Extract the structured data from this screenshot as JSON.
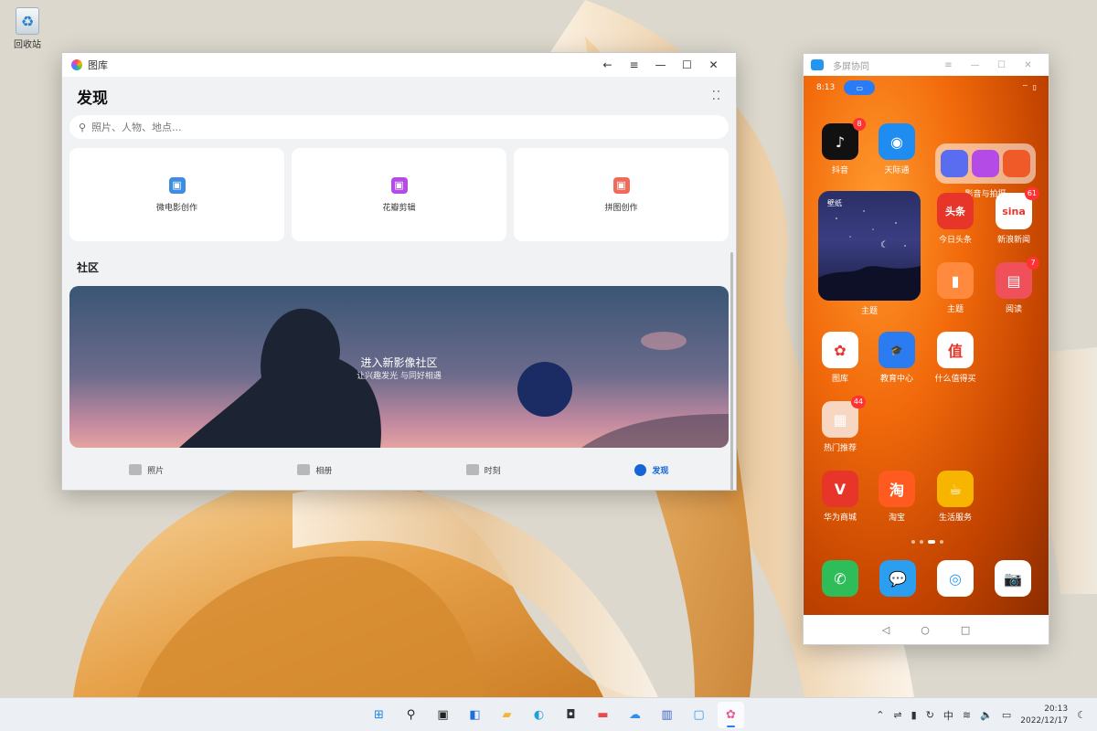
{
  "desktop": {
    "recycle_bin_label": "回收站"
  },
  "gallery_window": {
    "app_title": "图库",
    "page_title": "发现",
    "search": {
      "placeholder": "照片、人物、地点..."
    },
    "cards": [
      {
        "label": "微电影创作",
        "icon": "film-icon",
        "color": "#3d8de0"
      },
      {
        "label": "花瓣剪辑",
        "icon": "petal-edit-icon",
        "color": "#b44be6"
      },
      {
        "label": "拼图创作",
        "icon": "collage-icon",
        "color": "#f06a5a"
      }
    ],
    "section_title": "社区",
    "banner": {
      "title": "进入新影像社区",
      "subtitle": "让兴趣发光 与同好相遇"
    },
    "tabs": [
      {
        "label": "照片",
        "icon": "photo-icon",
        "active": false
      },
      {
        "label": "相册",
        "icon": "album-icon",
        "active": false
      },
      {
        "label": "时刻",
        "icon": "star-icon",
        "active": false
      },
      {
        "label": "发现",
        "icon": "discover-icon",
        "active": true
      }
    ]
  },
  "phone_window": {
    "title": "多屏协同",
    "status": {
      "time": "8:13"
    },
    "apps": [
      {
        "name": "抖音",
        "color": "#111111",
        "glyph": "♪",
        "badge": "8"
      },
      {
        "name": "天际通",
        "color": "#1e8cf0",
        "glyph": "◉",
        "badge": ""
      },
      {
        "name": "今日头条",
        "color": "#e8352a",
        "glyph": "头条",
        "badge": ""
      },
      {
        "name": "新浪新闻",
        "color": "#ffffff",
        "glyph": "sina",
        "badge": "61"
      },
      {
        "name": "主题",
        "color": "#ff8a3d",
        "glyph": "▮",
        "badge": ""
      },
      {
        "name": "阅读",
        "color": "#f0505a",
        "glyph": "▤",
        "badge": "7"
      },
      {
        "name": "图库",
        "color": "#ffffff",
        "glyph": "✿",
        "badge": ""
      },
      {
        "name": "教育中心",
        "color": "#2b7cf0",
        "glyph": "🎓",
        "badge": ""
      },
      {
        "name": "什么值得买",
        "color": "#ffffff",
        "glyph": "值",
        "badge": ""
      },
      {
        "name": "热门推荐",
        "color": "#f7d7c2",
        "glyph": "▦",
        "badge": "44"
      },
      {
        "name": "华为商城",
        "color": "#e8352a",
        "glyph": "V",
        "badge": ""
      },
      {
        "name": "淘宝",
        "color": "#ff5a1f",
        "glyph": "淘",
        "badge": ""
      },
      {
        "name": "生活服务",
        "color": "#f7b500",
        "glyph": "☕",
        "badge": ""
      }
    ],
    "folder_label": "影音与拍摄",
    "widget": {
      "title": "壁纸",
      "label": "主题"
    },
    "dock": [
      {
        "name": "phone",
        "color": "#2ebd59",
        "glyph": "✆"
      },
      {
        "name": "messages",
        "color": "#2b9ef0",
        "glyph": "💬"
      },
      {
        "name": "browser",
        "color": "#ffffff",
        "glyph": "◎"
      },
      {
        "name": "camera",
        "color": "#ffffff",
        "glyph": "📷"
      }
    ]
  },
  "taskbar": {
    "apps": [
      {
        "name": "start",
        "glyph": "⊞",
        "color": "#1e88e5"
      },
      {
        "name": "search",
        "glyph": "⚲",
        "color": "#222"
      },
      {
        "name": "task-view",
        "glyph": "▣",
        "color": "#222"
      },
      {
        "name": "widgets",
        "glyph": "◧",
        "color": "#1e6fd9"
      },
      {
        "name": "explorer",
        "glyph": "▰",
        "color": "#f2b632"
      },
      {
        "name": "edge",
        "glyph": "◐",
        "color": "#1fa0d8"
      },
      {
        "name": "store",
        "glyph": "◘",
        "color": "#333"
      },
      {
        "name": "app-red",
        "glyph": "▬",
        "color": "#e94a4a"
      },
      {
        "name": "cloud",
        "glyph": "☁",
        "color": "#2b8ef0"
      },
      {
        "name": "monitor",
        "glyph": "▥",
        "color": "#3a64c8"
      },
      {
        "name": "multiscreen",
        "glyph": "▢",
        "color": "#2b9ef0"
      },
      {
        "name": "gallery",
        "glyph": "✿",
        "color": "#e85a9b"
      }
    ],
    "tray_ime": "中",
    "clock_time": "20:13",
    "clock_date": "2022/12/17"
  }
}
